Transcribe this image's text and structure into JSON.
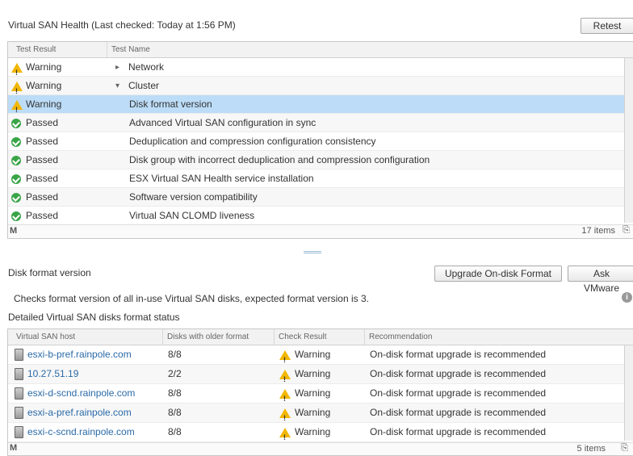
{
  "health": {
    "title": "Virtual SAN Health (Last checked: Today at 1:56 PM)",
    "retest_label": "Retest",
    "columns": [
      "Test Result",
      "Test Name"
    ],
    "rows": [
      {
        "result": "Warning",
        "name": "Network",
        "status": "warning",
        "expander": "▸"
      },
      {
        "result": "Warning",
        "name": "Cluster",
        "status": "warning",
        "expander": "▾"
      },
      {
        "result": "Warning",
        "name": "Disk format version",
        "status": "warning",
        "selected": true
      },
      {
        "result": "Passed",
        "name": "Advanced Virtual SAN configuration in sync",
        "status": "passed"
      },
      {
        "result": "Passed",
        "name": "Deduplication and compression configuration consistency",
        "status": "passed"
      },
      {
        "result": "Passed",
        "name": "Disk group with incorrect deduplication and compression configuration",
        "status": "passed"
      },
      {
        "result": "Passed",
        "name": "ESX Virtual SAN Health service installation",
        "status": "passed"
      },
      {
        "result": "Passed",
        "name": "Software version compatibility",
        "status": "passed"
      },
      {
        "result": "Passed",
        "name": "Virtual SAN CLOMD liveness",
        "status": "passed"
      }
    ],
    "items_count": "17 items"
  },
  "detail": {
    "title": "Disk format version",
    "upgrade_label": "Upgrade On-disk Format",
    "ask_label": "Ask VMware",
    "description": "Checks format version of all in-use Virtual SAN disks, expected format version is 3.",
    "subtitle": "Detailed Virtual SAN disks format status",
    "columns": [
      "Virtual SAN host",
      "Disks with older format",
      "Check Result",
      "Recommendation"
    ],
    "rows": [
      {
        "host": "esxi-b-pref.rainpole.com",
        "disks": "8/8",
        "result": "Warning",
        "rec": "On-disk format upgrade is recommended"
      },
      {
        "host": "10.27.51.19",
        "disks": "2/2",
        "result": "Warning",
        "rec": "On-disk format upgrade is recommended"
      },
      {
        "host": "esxi-d-scnd.rainpole.com",
        "disks": "8/8",
        "result": "Warning",
        "rec": "On-disk format upgrade is recommended"
      },
      {
        "host": "esxi-a-pref.rainpole.com",
        "disks": "8/8",
        "result": "Warning",
        "rec": "On-disk format upgrade is recommended"
      },
      {
        "host": "esxi-c-scnd.rainpole.com",
        "disks": "8/8",
        "result": "Warning",
        "rec": "On-disk format upgrade is recommended"
      }
    ],
    "items_count": "5 items"
  },
  "colors": {
    "selected_row": "#bcdcf7",
    "link": "#2a6aa7",
    "warning": "#f2b705",
    "passed": "#3aa548"
  }
}
